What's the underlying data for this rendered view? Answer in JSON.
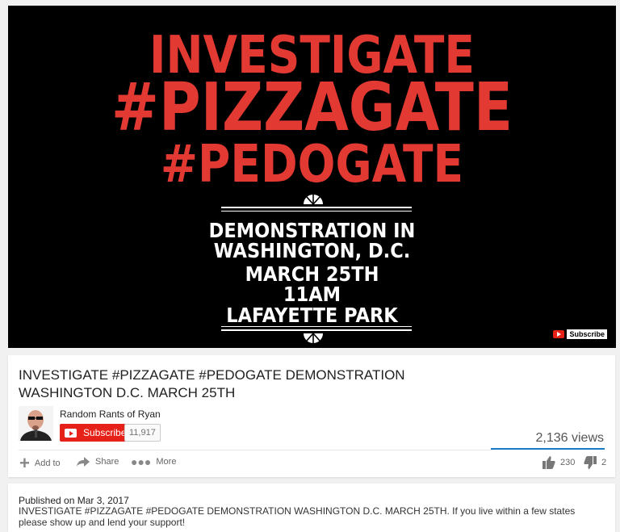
{
  "video": {
    "poster_lines_red": [
      "INVESTIGATE",
      "#PIZZAGATE",
      "#PEDOGATE"
    ],
    "poster_lines_white": [
      "DEMONSTRATION IN",
      "WASHINGTON, D.C.",
      "MARCH 25TH",
      "11AM",
      "LAFAYETTE PARK"
    ],
    "watermark_label": "Subscribe"
  },
  "info": {
    "title": "INVESTIGATE #PIZZAGATE #PEDOGATE DEMONSTRATION WASHINGTON D.C. MARCH 25TH",
    "channel_name": "Random Rants of Ryan",
    "subscribe_label": "Subscribe",
    "subscriber_count": "11,917",
    "views": "2,136 views",
    "actions": {
      "add_label": "Add to",
      "share_label": "Share",
      "more_label": "More"
    },
    "likes": "230",
    "dislikes": "2"
  },
  "description": {
    "published": "Published on Mar 3, 2017",
    "text": "INVESTIGATE #PIZZAGATE #PEDOGATE DEMONSTRATION WASHINGTON D.C. MARCH 25TH. If you live within a few states please show up and lend your support!"
  },
  "colors": {
    "accent_red": "#e62117",
    "poster_red": "#e23a32",
    "views_bar": "#167ac6"
  }
}
